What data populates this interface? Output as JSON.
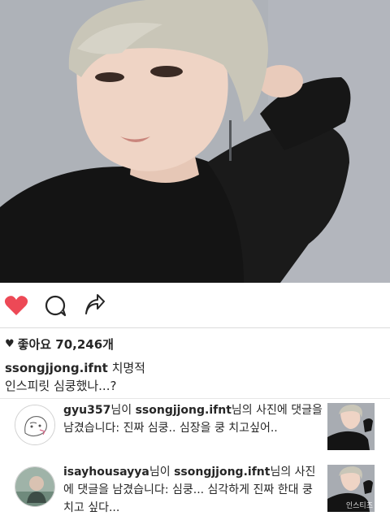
{
  "post": {
    "likes_label": "좋아요 70,246개",
    "caption_user": "ssongjjong.ifnt",
    "caption_rest": " 치명적",
    "caption_line2": "인스피릿 심쿵했나...?"
  },
  "notifications": [
    {
      "commenter": "gyu357",
      "mid_1": "님이 ",
      "owner": "ssongjjong.ifnt",
      "tail": "님의 사진에 댓글을 남겼습니다: 진짜 심쿵.. 심장을 쿵 치고싶어.."
    },
    {
      "commenter": "isayhousayya",
      "mid_1": "님이 ",
      "owner": "ssongjjong.ifnt",
      "tail": "님의 사진에 댓글을 남겼습니다: 심쿵... 심각하게 진짜 한대 쿵 치고 싶다..."
    }
  ],
  "watermark": "인스티즈",
  "colors": {
    "heart_red": "#ed4956",
    "text": "#262626",
    "divider": "#dbdbdb",
    "photo_bg": "#a9adb3"
  },
  "icons": [
    "heart-icon",
    "comment-icon",
    "share-icon"
  ]
}
